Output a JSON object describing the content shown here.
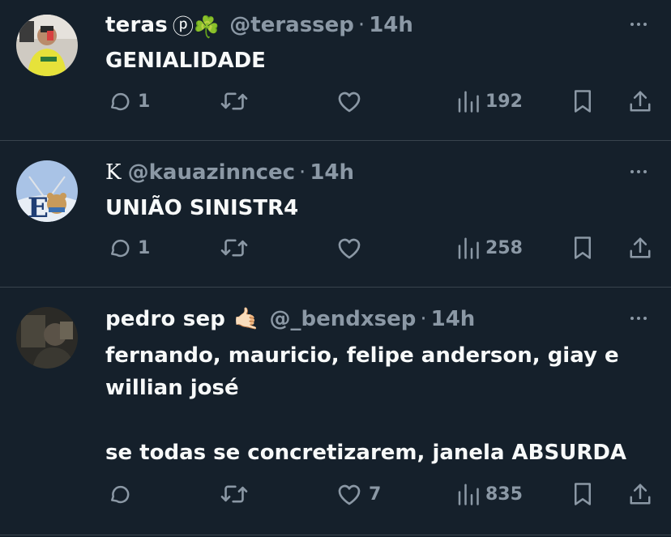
{
  "colors": {
    "background": "#15202b",
    "muted": "#8b98a5",
    "divider": "#38444d",
    "text": "#f7f9f9"
  },
  "tweets": [
    {
      "name": "teras",
      "badges": "ⓟ☘️",
      "handle": "@terassep",
      "sep": "·",
      "time": "14h",
      "text": "GENIALIDADE",
      "replies": "1",
      "retweets": "",
      "likes": "",
      "views": "192"
    },
    {
      "name": "K",
      "badges": "",
      "handle": "@kauazinncec",
      "sep": "·",
      "time": "14h",
      "text": "UNIÃO SINISTR4",
      "replies": "1",
      "retweets": "",
      "likes": "",
      "views": "258"
    },
    {
      "name": "pedro sep",
      "badges": "🤙🏻",
      "handle": "@_bendxsep",
      "sep": "·",
      "time": "14h",
      "text": "fernando, mauricio, felipe anderson, giay e\nwillian josé\n\nse todas se concretizarem, janela ABSURDA",
      "replies": "",
      "retweets": "",
      "likes": "7",
      "views": "835"
    }
  ],
  "icons": {
    "reply": "reply-icon",
    "retweet": "retweet-icon",
    "like": "heart-icon",
    "views": "views-icon",
    "bookmark": "bookmark-icon",
    "share": "share-icon",
    "more": "more-icon"
  }
}
